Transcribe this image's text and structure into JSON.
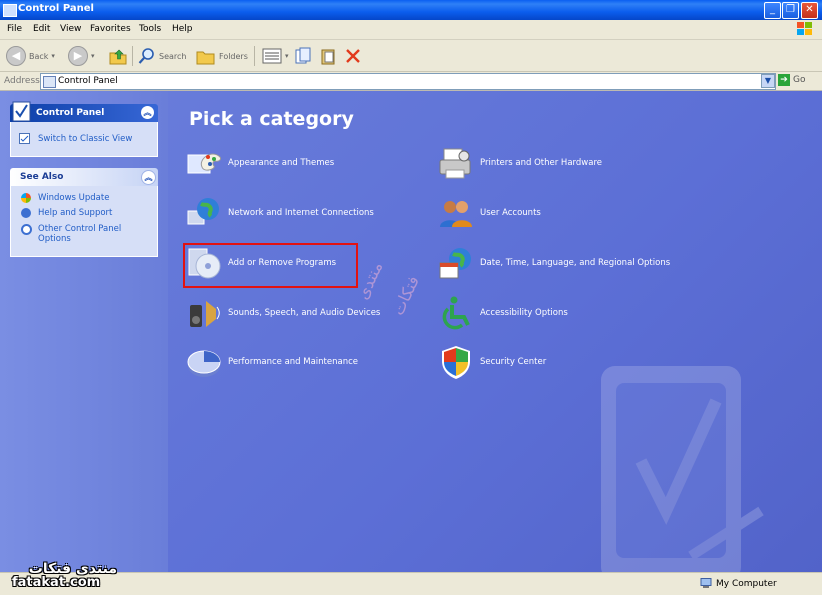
{
  "window": {
    "title": "Control Panel"
  },
  "menu": [
    "File",
    "Edit",
    "View",
    "Favorites",
    "Tools",
    "Help"
  ],
  "toolbar": {
    "back": "Back",
    "search": "Search",
    "folders": "Folders"
  },
  "address": {
    "label": "Address",
    "value": "Control Panel",
    "go": "Go"
  },
  "left_panel": {
    "control_panel": {
      "title": "Control Panel",
      "link": "Switch to Classic View"
    },
    "see_also": {
      "title": "See Also",
      "links": [
        "Windows Update",
        "Help and Support",
        "Other Control Panel",
        "Options"
      ]
    }
  },
  "main": {
    "heading": "Pick a category",
    "categories_left": [
      "Appearance and Themes",
      "Network and Internet Connections",
      "Add or Remove Programs",
      "Sounds, Speech, and Audio Devices",
      "Performance and Maintenance"
    ],
    "categories_right": [
      "Printers and Other Hardware",
      "User Accounts",
      "Date, Time, Language, and Regional Options",
      "Accessibility Options",
      "Security Center"
    ],
    "highlight_color": "#e21212"
  },
  "watermark": {
    "line1": "منتدى",
    "line2": "فتكات"
  },
  "status": {
    "text": "My Computer"
  },
  "site_mark": {
    "arabic": "منتدى فتكات",
    "latin": "fatakat.com"
  },
  "colors": {
    "content_bg": "#5c6fd6",
    "title_bar": "#0a5ff1"
  }
}
